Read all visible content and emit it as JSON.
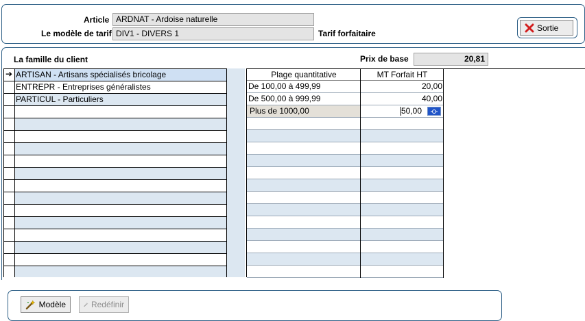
{
  "header": {
    "article_label": "Article",
    "article_value": "ARDNAT - Ardoise naturelle",
    "modele_label": "Le modèle de tarif",
    "modele_value": "DIV1 - DIVERS 1",
    "tarif_type": "Tarif forfaitaire",
    "sortie_label": "Sortie"
  },
  "main": {
    "famille_label": "La famille du client",
    "prix_base_label": "Prix de base",
    "prix_base_value": "20,81"
  },
  "familles": [
    {
      "label": "ARTISAN - Artisans spécialisés bricolage",
      "selected": true
    },
    {
      "label": "ENTREPR - Entreprises généralistes"
    },
    {
      "label": "PARTICUL - Particuliers"
    }
  ],
  "grid": {
    "columns": [
      "Plage quantitative",
      "MT Forfait HT"
    ],
    "rows": [
      {
        "plage": "De 100,00 à 499,99",
        "montant": "20,00"
      },
      {
        "plage": "De 500,00 à 999,99",
        "montant": "40,00"
      },
      {
        "plage": "Plus de 1000,00",
        "montant": "50,00",
        "editing": true
      }
    ]
  },
  "footer": {
    "modele_btn": "Modèle",
    "redefinir_btn": "Redéfinir"
  },
  "colors": {
    "accent": "#2d5f86",
    "row_alt": "#dce7f1",
    "field_bg": "#e4e4e4"
  }
}
